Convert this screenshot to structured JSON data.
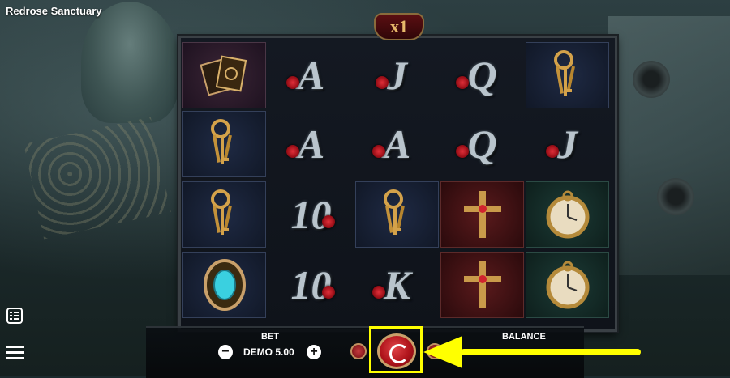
{
  "app": {
    "title": "Redrose Sanctuary"
  },
  "multiplier": "x1",
  "reels": [
    [
      {
        "symbol": "tarot-cards",
        "label": ""
      },
      {
        "symbol": "keys",
        "label": ""
      },
      {
        "symbol": "keys",
        "label": ""
      },
      {
        "symbol": "gem-amulet",
        "label": ""
      }
    ],
    [
      {
        "symbol": "letter-a",
        "label": "A"
      },
      {
        "symbol": "letter-a",
        "label": "A"
      },
      {
        "symbol": "ten",
        "label": "10"
      },
      {
        "symbol": "ten",
        "label": "10"
      }
    ],
    [
      {
        "symbol": "letter-j",
        "label": "J"
      },
      {
        "symbol": "letter-a",
        "label": "A"
      },
      {
        "symbol": "keys",
        "label": ""
      },
      {
        "symbol": "letter-k",
        "label": "K"
      }
    ],
    [
      {
        "symbol": "letter-q",
        "label": "Q"
      },
      {
        "symbol": "letter-q",
        "label": "Q"
      },
      {
        "symbol": "cross",
        "label": ""
      },
      {
        "symbol": "cross",
        "label": ""
      }
    ],
    [
      {
        "symbol": "keys",
        "label": ""
      },
      {
        "symbol": "letter-j",
        "label": "J"
      },
      {
        "symbol": "pocket-watch",
        "label": ""
      },
      {
        "symbol": "pocket-watch",
        "label": ""
      }
    ]
  ],
  "controls": {
    "bet_label": "BET",
    "bet_value": "DEMO 5.00",
    "balance_label": "BALANCE",
    "minus_label": "−",
    "plus_label": "+"
  },
  "colors": {
    "highlight": "#ffff00",
    "spin": "#b0141b",
    "gold": "#c9a06a"
  }
}
